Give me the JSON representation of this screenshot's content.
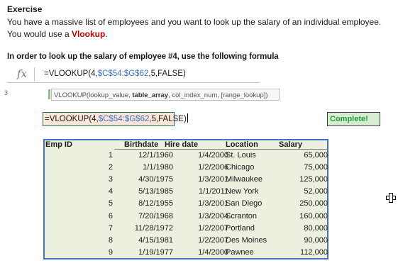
{
  "exercise": {
    "title": "Exercise",
    "line1": "You have a massive list of employees and you want to look up the salary of an individual employee.",
    "line2_prefix": "You would use a ",
    "line2_highlight": "Vlookup",
    "line2_suffix": "."
  },
  "instruction": "In order to look up the salary of employee #4, use the following formula",
  "formula_bar": {
    "fx_label": "fx",
    "formula_prefix": "=VLOOKUP(4,",
    "formula_range": "$C$54:$G$62",
    "formula_suffix": ",5,FALSE)"
  },
  "tooltip": {
    "fn": "VLOOKUP(lookup_value, ",
    "bold_arg": "table_array",
    "rest": ", col_index_num, [range_lookup])"
  },
  "stub_mark": "3",
  "cell_edit": {
    "prefix": "=VLOOKUP(4,",
    "range": "$C$54:$G$62",
    "suffix": ",5,FALSE)"
  },
  "complete_label": "Complete!",
  "table": {
    "headers": {
      "emp_id": "Emp ID",
      "birthdate": "Birthdate",
      "hire_date": "Hire date",
      "location": "Location",
      "salary": "Salary"
    },
    "rows": [
      {
        "id": "1",
        "birth": "12/1/1960",
        "hire": "1/4/2000",
        "loc": "St. Louis",
        "salary": "65,000"
      },
      {
        "id": "2",
        "birth": "1/1/1980",
        "hire": "1/2/2006",
        "loc": "Chicago",
        "salary": "75,000"
      },
      {
        "id": "3",
        "birth": "4/30/1975",
        "hire": "1/3/2001",
        "loc": "Milwaukee",
        "salary": "125,000"
      },
      {
        "id": "4",
        "birth": "5/13/1985",
        "hire": "1/1/2011",
        "loc": "New York",
        "salary": "52,000"
      },
      {
        "id": "5",
        "birth": "8/12/1955",
        "hire": "1/3/2001",
        "loc": "San Diego",
        "salary": "250,000"
      },
      {
        "id": "6",
        "birth": "7/20/1968",
        "hire": "1/3/2004",
        "loc": "Scranton",
        "salary": "160,000"
      },
      {
        "id": "7",
        "birth": "11/28/1972",
        "hire": "1/2/2007",
        "loc": "Portland",
        "salary": "80,000"
      },
      {
        "id": "8",
        "birth": "4/15/1981",
        "hire": "1/2/2007",
        "loc": "Des Moines",
        "salary": "90,000"
      },
      {
        "id": "9",
        "birth": "1/19/1977",
        "hire": "1/4/2000",
        "loc": "Pawnee",
        "salary": "112,000"
      }
    ]
  },
  "colors": {
    "highlight_red": "#c00000",
    "range_blue": "#3a72c4",
    "table_fill": "#ebf1de",
    "table_border": "#4472c4",
    "edit_cell_fill": "#fbe4d8",
    "complete_green": "#1e9e3e"
  },
  "icons": {
    "fx": "function-fx-icon",
    "cursor": "cell-select-cross-icon"
  }
}
